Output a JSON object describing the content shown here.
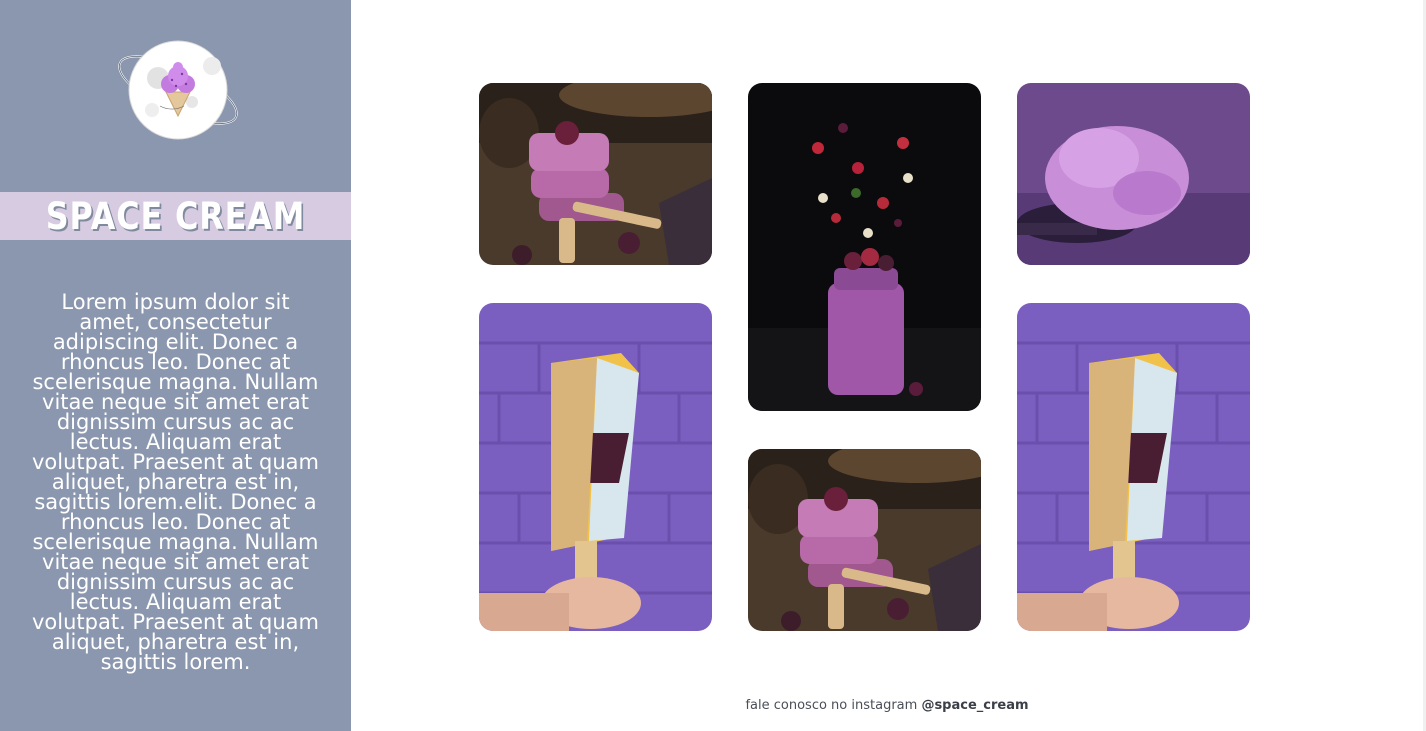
{
  "brand": {
    "name": "SPACE CREAM"
  },
  "about": {
    "text": "Lorem ipsum dolor sit amet, consectetur adipiscing elit. Donec a rhoncus leo. Donec at scelerisque magna. Nullam vitae neque sit amet erat dignissim cursus ac ac lectus. Aliquam erat volutpat. Praesent at quam aliquet, pharetra est in, sagittis lorem.elit. Donec a rhoncus leo. Donec at scelerisque magna. Nullam vitae neque sit amet erat dignissim cursus ac ac lectus. Aliquam erat volutpat. Praesent at quam aliquet, pharetra est in, sagittis lorem."
  },
  "gallery": [
    {
      "subject": "berry-popsicle-stack"
    },
    {
      "subject": "berry-smoothie-jar"
    },
    {
      "subject": "purple-ice-cream-spoon"
    },
    {
      "subject": "nut-coated-popsicle"
    },
    {
      "subject": "berry-popsicle-stack"
    },
    {
      "subject": "nut-coated-popsicle"
    }
  ],
  "footer": {
    "text": "fale conosco no instagram ",
    "handle": "@space_cream"
  },
  "colors": {
    "sidebar": "#8a97ae",
    "brand_band": "#d6cbe0",
    "accent_purple": "#7b5fc0"
  }
}
